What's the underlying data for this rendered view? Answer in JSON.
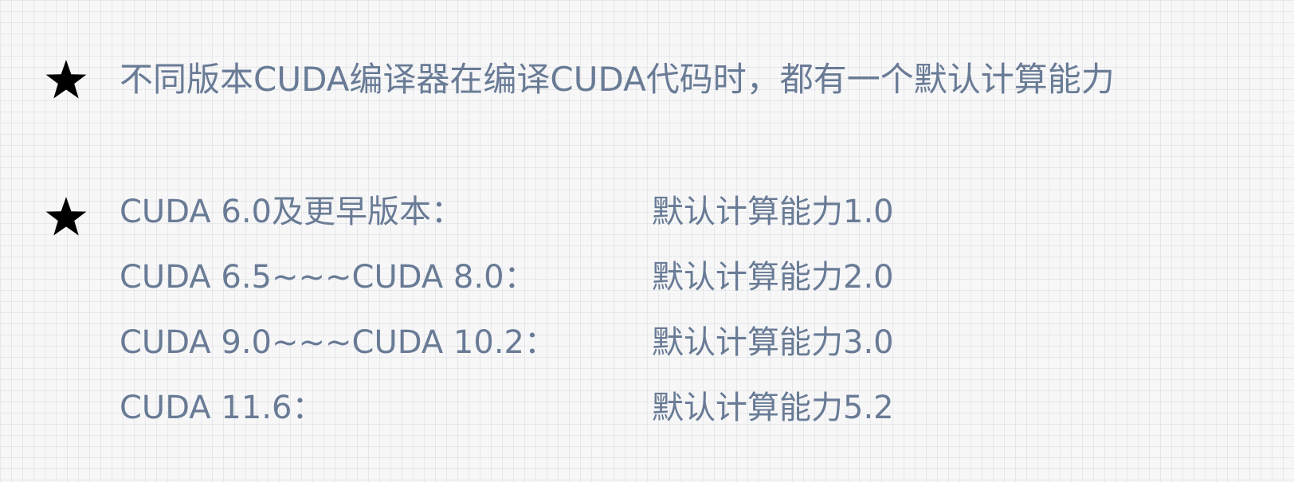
{
  "icons": {
    "bullet": "black-star-icon"
  },
  "colors": {
    "text": "#697b95",
    "bullet": "#000000",
    "background": "#f7f7f8"
  },
  "headline": "不同版本CUDA编译器在编译CUDA代码时，都有一个默认计算能力",
  "rows": [
    {
      "version": "CUDA 6.0及更早版本：",
      "capability": "默认计算能力1.0"
    },
    {
      "version": "CUDA 6.5~~~CUDA 8.0：",
      "capability": "默认计算能力2.0"
    },
    {
      "version": "CUDA 9.0~~~CUDA 10.2：",
      "capability": "默认计算能力3.0"
    },
    {
      "version": "CUDA 11.6：",
      "capability": "默认计算能力5.2"
    }
  ]
}
